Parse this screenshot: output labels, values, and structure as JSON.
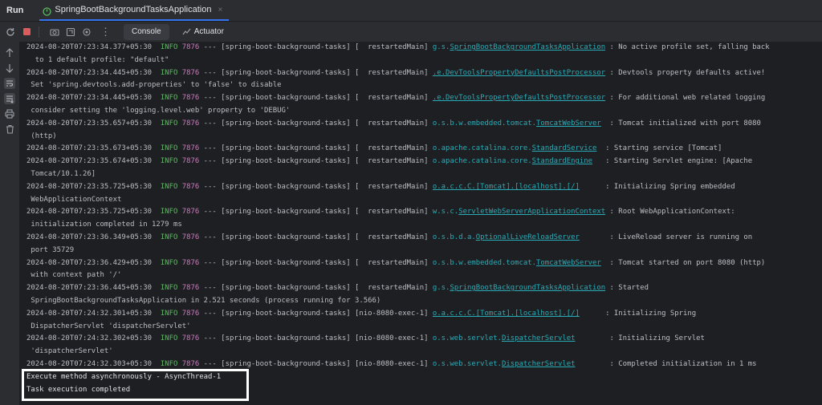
{
  "topbar": {
    "run_label": "Run",
    "tab_title": "SpringBootBackgroundTasksApplication",
    "tab_close": "×"
  },
  "toolbar": {
    "tabs": [
      {
        "label": "Console",
        "icon": "console-icon",
        "active": true
      },
      {
        "label": "Actuator",
        "icon": "actuator-icon",
        "active": false
      }
    ],
    "more": "⋮"
  },
  "gutter_icons": [
    "arrow-up-icon",
    "arrow-down-icon",
    "soft-wrap-icon",
    "scroll-to-end-icon",
    "print-icon",
    "trash-icon"
  ],
  "colors": {
    "info": "#5fb865",
    "pid": "#c77dbb",
    "logger": "#2aacb8",
    "accent": "#3574f0"
  },
  "log_lines": [
    {
      "ts": "2024-08-20T07:23:34.377+05:30",
      "level": "INFO",
      "pid": "7876",
      "sep": "---",
      "app": "[spring-boot-background-tasks]",
      "thread": "[  restartedMain]",
      "logger_prefix": "g.s.",
      "logger_link": "SpringBootBackgroundTasksApplication",
      "logger_pad": " ",
      "msg": ": No active profile set, falling back"
    },
    {
      "cont": "  to 1 default profile: \"default\""
    },
    {
      "ts": "2024-08-20T07:23:34.445+05:30",
      "level": "INFO",
      "pid": "7876",
      "sep": "---",
      "app": "[spring-boot-background-tasks]",
      "thread": "[  restartedMain]",
      "logger_prefix": "",
      "logger_link": ".e.DevToolsPropertyDefaultsPostProcessor",
      "logger_pad": " ",
      "msg": ": Devtools property defaults active!"
    },
    {
      "cont": " Set 'spring.devtools.add-properties' to 'false' to disable"
    },
    {
      "ts": "2024-08-20T07:23:34.445+05:30",
      "level": "INFO",
      "pid": "7876",
      "sep": "---",
      "app": "[spring-boot-background-tasks]",
      "thread": "[  restartedMain]",
      "logger_prefix": "",
      "logger_link": ".e.DevToolsPropertyDefaultsPostProcessor",
      "logger_pad": " ",
      "msg": ": For additional web related logging"
    },
    {
      "cont": " consider setting the 'logging.level.web' property to 'DEBUG'"
    },
    {
      "ts": "2024-08-20T07:23:35.657+05:30",
      "level": "INFO",
      "pid": "7876",
      "sep": "---",
      "app": "[spring-boot-background-tasks]",
      "thread": "[  restartedMain]",
      "logger_prefix": "o.s.b.w.embedded.tomcat.",
      "logger_link": "TomcatWebServer",
      "logger_pad": "  ",
      "msg": ": Tomcat initialized with port 8080"
    },
    {
      "cont": " (http)"
    },
    {
      "ts": "2024-08-20T07:23:35.673+05:30",
      "level": "INFO",
      "pid": "7876",
      "sep": "---",
      "app": "[spring-boot-background-tasks]",
      "thread": "[  restartedMain]",
      "logger_prefix": "o.apache.catalina.core.",
      "logger_link": "StandardService",
      "logger_pad": "  ",
      "msg": ": Starting service [Tomcat]"
    },
    {
      "ts": "2024-08-20T07:23:35.674+05:30",
      "level": "INFO",
      "pid": "7876",
      "sep": "---",
      "app": "[spring-boot-background-tasks]",
      "thread": "[  restartedMain]",
      "logger_prefix": "o.apache.catalina.core.",
      "logger_link": "StandardEngine",
      "logger_pad": "   ",
      "msg": ": Starting Servlet engine: [Apache"
    },
    {
      "cont": " Tomcat/10.1.26]"
    },
    {
      "ts": "2024-08-20T07:23:35.725+05:30",
      "level": "INFO",
      "pid": "7876",
      "sep": "---",
      "app": "[spring-boot-background-tasks]",
      "thread": "[  restartedMain]",
      "logger_prefix": "",
      "logger_link": "o.a.c.c.C.[Tomcat].[localhost].[/]",
      "logger_pad": "      ",
      "msg": ": Initializing Spring embedded"
    },
    {
      "cont": " WebApplicationContext"
    },
    {
      "ts": "2024-08-20T07:23:35.725+05:30",
      "level": "INFO",
      "pid": "7876",
      "sep": "---",
      "app": "[spring-boot-background-tasks]",
      "thread": "[  restartedMain]",
      "logger_prefix": "w.s.c.",
      "logger_link": "ServletWebServerApplicationContext",
      "logger_pad": " ",
      "msg": ": Root WebApplicationContext:"
    },
    {
      "cont": " initialization completed in 1279 ms"
    },
    {
      "ts": "2024-08-20T07:23:36.349+05:30",
      "level": "INFO",
      "pid": "7876",
      "sep": "---",
      "app": "[spring-boot-background-tasks]",
      "thread": "[  restartedMain]",
      "logger_prefix": "o.s.b.d.a.",
      "logger_link": "OptionalLiveReloadServer",
      "logger_pad": "       ",
      "msg": ": LiveReload server is running on"
    },
    {
      "cont": " port 35729"
    },
    {
      "ts": "2024-08-20T07:23:36.429+05:30",
      "level": "INFO",
      "pid": "7876",
      "sep": "---",
      "app": "[spring-boot-background-tasks]",
      "thread": "[  restartedMain]",
      "logger_prefix": "o.s.b.w.embedded.tomcat.",
      "logger_link": "TomcatWebServer",
      "logger_pad": "  ",
      "msg": ": Tomcat started on port 8080 (http)"
    },
    {
      "cont": " with context path '/'"
    },
    {
      "ts": "2024-08-20T07:23:36.445+05:30",
      "level": "INFO",
      "pid": "7876",
      "sep": "---",
      "app": "[spring-boot-background-tasks]",
      "thread": "[  restartedMain]",
      "logger_prefix": "g.s.",
      "logger_link": "SpringBootBackgroundTasksApplication",
      "logger_pad": " ",
      "msg": ": Started"
    },
    {
      "cont": " SpringBootBackgroundTasksApplication in 2.521 seconds (process running for 3.566)"
    },
    {
      "ts": "2024-08-20T07:24:32.301+05:30",
      "level": "INFO",
      "pid": "7876",
      "sep": "---",
      "app": "[spring-boot-background-tasks]",
      "thread": "[nio-8080-exec-1]",
      "logger_prefix": "",
      "logger_link": "o.a.c.c.C.[Tomcat].[localhost].[/]",
      "logger_pad": "      ",
      "msg": ": Initializing Spring"
    },
    {
      "cont": " DispatcherServlet 'dispatcherServlet'"
    },
    {
      "ts": "2024-08-20T07:24:32.302+05:30",
      "level": "INFO",
      "pid": "7876",
      "sep": "---",
      "app": "[spring-boot-background-tasks]",
      "thread": "[nio-8080-exec-1]",
      "logger_prefix": "o.s.web.servlet.",
      "logger_link": "DispatcherServlet",
      "logger_pad": "        ",
      "msg": ": Initializing Servlet"
    },
    {
      "cont": " 'dispatcherServlet'"
    },
    {
      "ts": "2024-08-20T07:24:32.303+05:30",
      "level": "INFO",
      "pid": "7876",
      "sep": "---",
      "app": "[spring-boot-background-tasks]",
      "thread": "[nio-8080-exec-1]",
      "logger_prefix": "o.s.web.servlet.",
      "logger_link": "DispatcherServlet",
      "logger_pad": "        ",
      "msg": ": Completed initialization in 1 ms"
    },
    {
      "plain": "Execute method asynchronously - AsyncThread-1"
    },
    {
      "plain": "Task execution completed"
    }
  ]
}
